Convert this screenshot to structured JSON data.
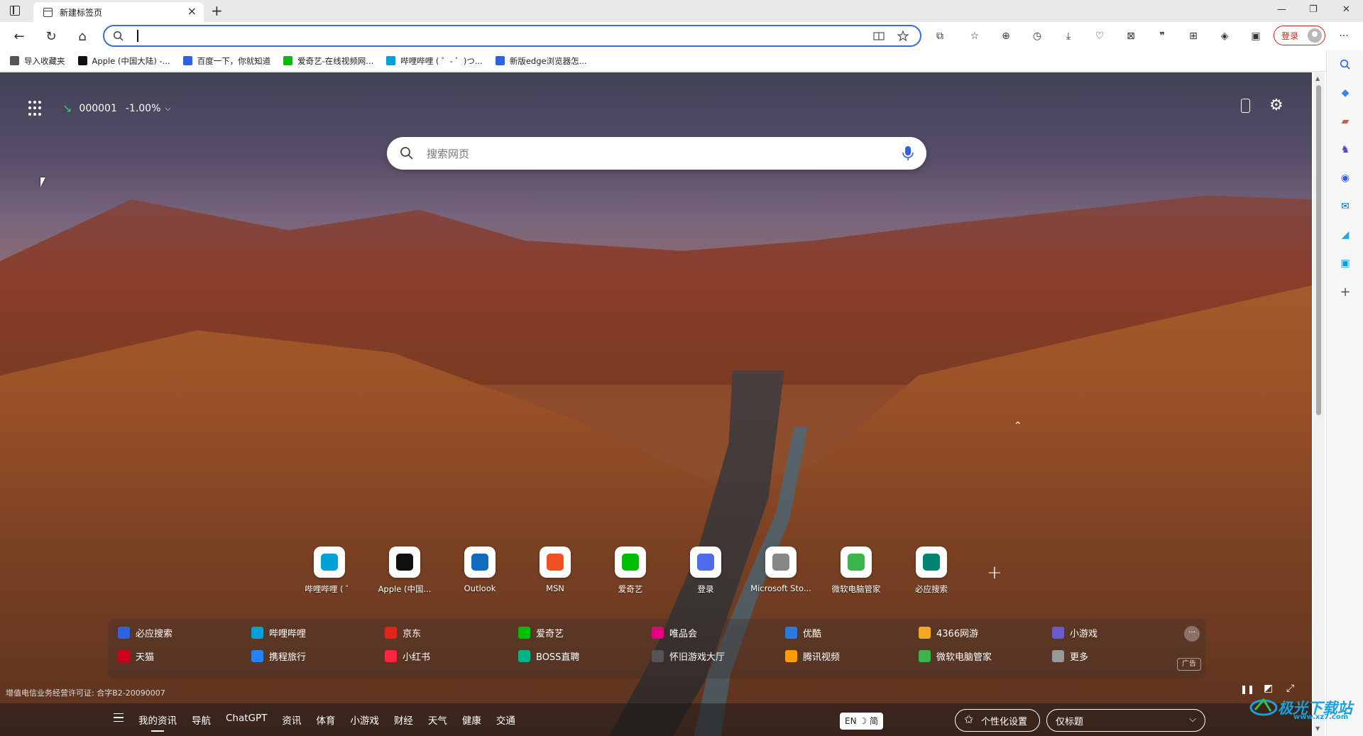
{
  "tab": {
    "title": "新建标签页",
    "close": "×",
    "new": "+"
  },
  "window": {
    "minimize": "—",
    "restore": "❐",
    "close": "✕"
  },
  "toolbar": {
    "address_value": "",
    "login_label": "登录",
    "more": "···"
  },
  "favorites": [
    {
      "label": "导入收藏夹",
      "color": "#555"
    },
    {
      "label": "Apple (中国大陆) -...",
      "color": "#111"
    },
    {
      "label": "百度一下，你就知道",
      "color": "#2f62e0"
    },
    {
      "label": "爱奇艺-在线视频网...",
      "color": "#00be06"
    },
    {
      "label": "哔哩哔哩 ( ゜- ゜)つ...",
      "color": "#00a1d6"
    },
    {
      "label": "新版edge浏览器怎...",
      "color": "#2f62e0"
    }
  ],
  "stock": {
    "code": "000001",
    "change": "-1.00%"
  },
  "search": {
    "placeholder": "搜索网页"
  },
  "quicklinks": [
    {
      "label": "哔哩哔哩 ( ゜",
      "color": "#00a1d6"
    },
    {
      "label": "Apple (中国...",
      "color": "#111"
    },
    {
      "label": "Outlook",
      "color": "#0f6cbd"
    },
    {
      "label": "MSN",
      "color": "#f25022"
    },
    {
      "label": "爱奇艺",
      "color": "#00be06"
    },
    {
      "label": "登录",
      "color": "#4f6bed"
    },
    {
      "label": "Microsoft Sto...",
      "color": "#888"
    },
    {
      "label": "微软电脑管家",
      "color": "#3bb44a"
    },
    {
      "label": "必应搜索",
      "color": "#008373"
    }
  ],
  "quicklink_add": "+",
  "nav_links": [
    {
      "label": "必应搜索",
      "color": "#2f62e0"
    },
    {
      "label": "哔哩哔哩",
      "color": "#00a1d6"
    },
    {
      "label": "京东",
      "color": "#e1251b"
    },
    {
      "label": "爱奇艺",
      "color": "#00be06"
    },
    {
      "label": "唯品会",
      "color": "#e5007f"
    },
    {
      "label": "优酷",
      "color": "#2a7ae0"
    },
    {
      "label": "4366网游",
      "color": "#f5a623"
    },
    {
      "label": "小游戏",
      "color": "#6a5acd"
    },
    {
      "label": "天猫",
      "color": "#d0021b"
    },
    {
      "label": "携程旅行",
      "color": "#2681ff"
    },
    {
      "label": "小红书",
      "color": "#ff2442"
    },
    {
      "label": "BOSS直聘",
      "color": "#00b38a"
    },
    {
      "label": "怀旧游戏大厅",
      "color": "#555"
    },
    {
      "label": "腾讯视频",
      "color": "#ff9d00"
    },
    {
      "label": "微软电脑管家",
      "color": "#3bb44a"
    },
    {
      "label": "更多",
      "color": "#999"
    }
  ],
  "nav_more": "···",
  "ad_badge": "广告",
  "license": "增值电信业务经营许可证: 合字B2-20090007",
  "bottom_nav": {
    "items": [
      "我的资讯",
      "导航",
      "ChatGPT",
      "资讯",
      "体育",
      "小游戏",
      "财经",
      "天气",
      "健康",
      "交通"
    ],
    "lang": "EN ☽ 简",
    "personalize": "个性化设置",
    "layout": "仅标题"
  },
  "watermark": {
    "text": "极光下载站",
    "sub": "www.xz7.com"
  }
}
